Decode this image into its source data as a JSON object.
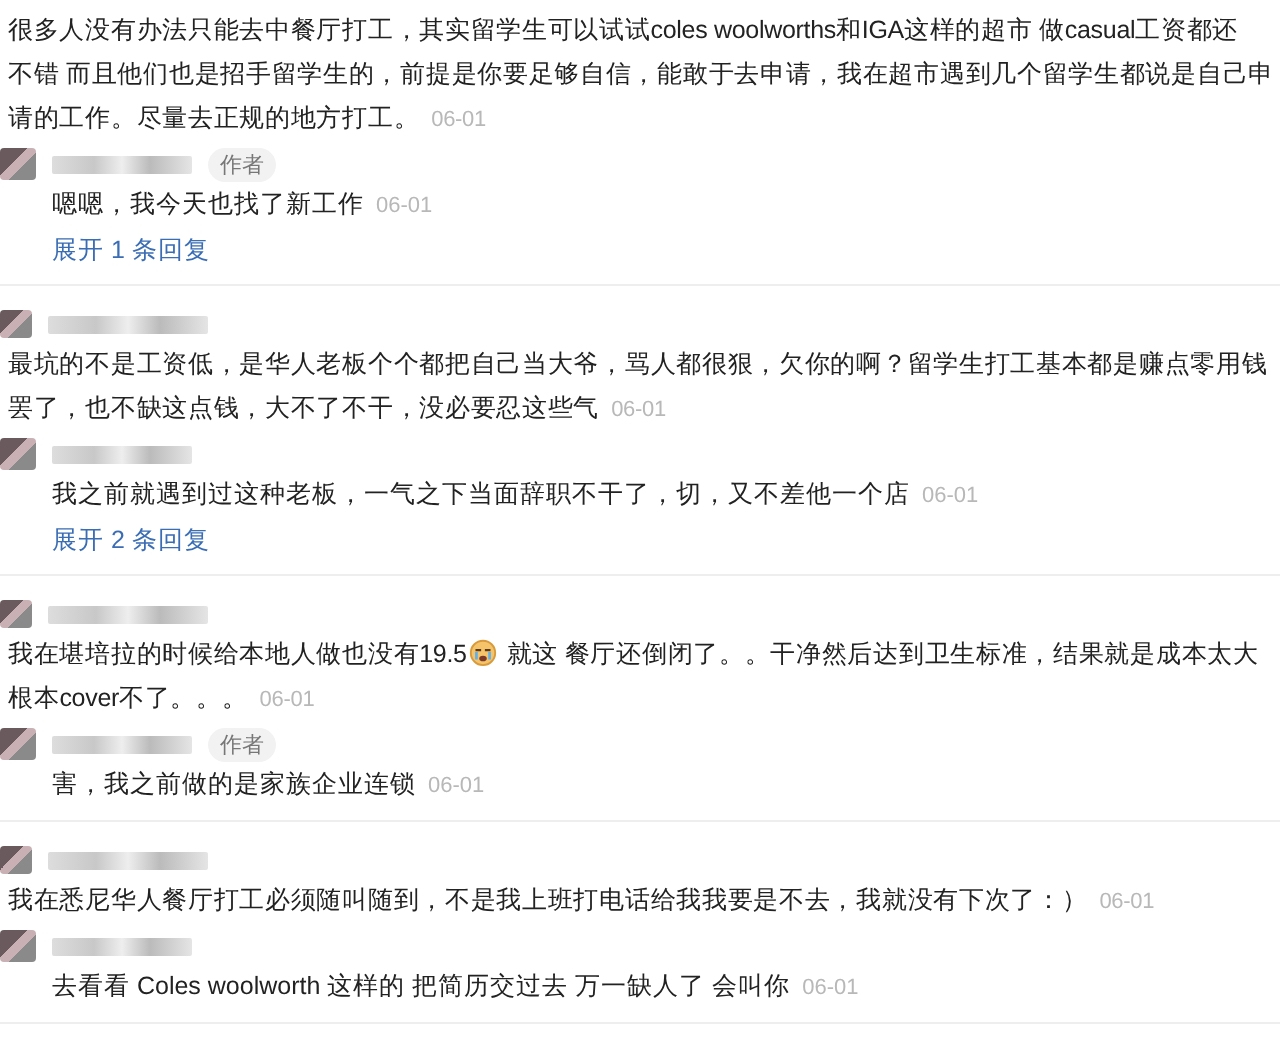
{
  "threads": [
    {
      "header": false,
      "segments": [
        {
          "kind": "text",
          "text": "很多人没有办法只能去中餐厅打工，其实留学生可以试试coles woolworths和IGA这样的超市 做casual工资都还"
        },
        {
          "kind": "break"
        },
        {
          "kind": "text",
          "text": "不错 而且他们也是招手留学生的，前提是你要足够自信，能敢于去申请，我在超市遇到几个留学生都说是自己申"
        },
        {
          "kind": "break"
        },
        {
          "kind": "text",
          "text": "请的工作。尽量去正规的地方打工。"
        }
      ],
      "date": "06-01",
      "replies": [
        {
          "author_badge": "作者",
          "text": "嗯嗯，我今天也找了新工作",
          "date": "06-01"
        }
      ],
      "expand": "展开 1 条回复"
    },
    {
      "header": true,
      "segments": [
        {
          "kind": "text",
          "text": "最坑的不是工资低，是华人老板个个都把自己当大爷，骂人都很狠，欠你的啊？留学生打工基本都是赚点零用钱"
        },
        {
          "kind": "break"
        },
        {
          "kind": "text",
          "text": "罢了，也不缺这点钱，大不了不干，没必要忍这些气"
        }
      ],
      "date": "06-01",
      "replies": [
        {
          "text": "我之前就遇到过这种老板，一气之下当面辞职不干了，切，又不差他一个店",
          "date": "06-01"
        }
      ],
      "expand": "展开 2 条回复"
    },
    {
      "header": true,
      "segments": [
        {
          "kind": "text",
          "text": "我在堪培拉的时候给本地人做也没有19.5"
        },
        {
          "kind": "emoji"
        },
        {
          "kind": "text",
          "text": "就这 餐厅还倒闭了。。干净然后达到卫生标准，结果就是成本太大"
        },
        {
          "kind": "break"
        },
        {
          "kind": "text",
          "text": "根本cover不了。。。"
        }
      ],
      "date": "06-01",
      "replies": [
        {
          "author_badge": "作者",
          "text": "害，我之前做的是家族企业连锁",
          "date": "06-01"
        }
      ]
    },
    {
      "header": true,
      "segments": [
        {
          "kind": "text",
          "text": "我在悉尼华人餐厅打工必须随叫随到，不是我上班打电话给我我要是不去，我就没有下次了：）"
        }
      ],
      "date": "06-01",
      "replies": [
        {
          "text": "去看看 Coles woolworth 这样的 把简历交过去 万一缺人了 会叫你",
          "date": "06-01"
        }
      ]
    }
  ]
}
